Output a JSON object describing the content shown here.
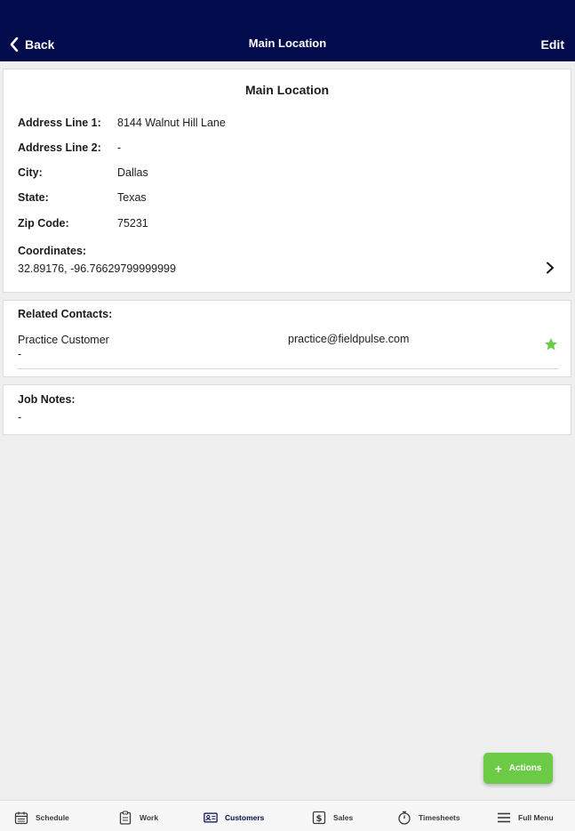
{
  "header": {
    "back_label": "Back",
    "title": "Main Location",
    "edit_label": "Edit"
  },
  "location": {
    "card_title": "Main Location",
    "fields": [
      {
        "label": "Address Line 1:",
        "value": "8144 Walnut Hill Lane"
      },
      {
        "label": "Address Line 2:",
        "value": "-"
      },
      {
        "label": "City:",
        "value": "Dallas"
      },
      {
        "label": "State:",
        "value": "Texas"
      },
      {
        "label": "Zip Code:",
        "value": "75231"
      }
    ],
    "coordinates_label": "Coordinates:",
    "coordinates_value": "32.89176, -96.76629799999999"
  },
  "related_contacts": {
    "label": "Related Contacts:",
    "contacts": [
      {
        "name": "Practice Customer",
        "sub": "-",
        "email": "practice@fieldpulse.com",
        "icon": "star-icon"
      }
    ]
  },
  "job_notes": {
    "label": "Job Notes:",
    "value": "-"
  },
  "fab": {
    "label": "Actions",
    "plus": "+"
  },
  "tabs": [
    {
      "label": "Schedule",
      "icon": "calendar-icon"
    },
    {
      "label": "Work",
      "icon": "clipboard-icon"
    },
    {
      "label": "Customers",
      "icon": "contact-card-icon",
      "active": true
    },
    {
      "label": "Sales",
      "icon": "dollar-icon"
    },
    {
      "label": "Timesheets",
      "icon": "stopwatch-icon"
    },
    {
      "label": "Full Menu",
      "icon": "menu-icon"
    }
  ],
  "colors": {
    "header_bg": "#020c4d",
    "accent_green": "#6bcb47",
    "background": "#efefef"
  }
}
